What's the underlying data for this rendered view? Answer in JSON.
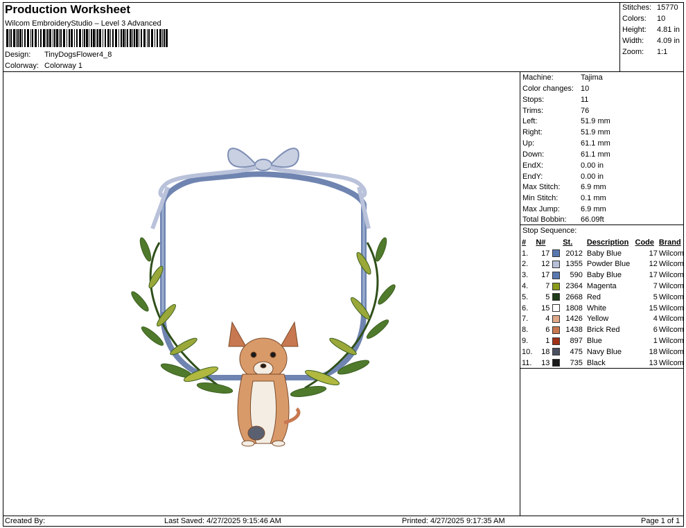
{
  "header": {
    "title": "Production Worksheet",
    "subtitle": "Wilcom EmbroideryStudio – Level 3 Advanced",
    "design_label": "Design:",
    "design_value": "TinyDogsFlower4_8",
    "colorway_label": "Colorway:",
    "colorway_value": "Colorway 1"
  },
  "summary": [
    {
      "label": "Stitches:",
      "value": "15770"
    },
    {
      "label": "Colors:",
      "value": "10"
    },
    {
      "label": "Height:",
      "value": "4.81 in"
    },
    {
      "label": "Width:",
      "value": "4.09 in"
    },
    {
      "label": "Zoom:",
      "value": "1:1"
    }
  ],
  "machine_info": [
    {
      "label": "Machine:",
      "value": "Tajima"
    },
    {
      "label": "Color changes:",
      "value": "10"
    },
    {
      "label": "Stops:",
      "value": "11"
    },
    {
      "label": "Trims:",
      "value": "76"
    },
    {
      "label": "Left:",
      "value": "51.9 mm"
    },
    {
      "label": "Right:",
      "value": "51.9 mm"
    },
    {
      "label": "Up:",
      "value": "61.1 mm"
    },
    {
      "label": "Down:",
      "value": "61.1 mm"
    },
    {
      "label": "EndX:",
      "value": "0.00 in"
    },
    {
      "label": "EndY:",
      "value": "0.00 in"
    },
    {
      "label": "Max Stitch:",
      "value": "6.9 mm"
    },
    {
      "label": "Min Stitch:",
      "value": "0.1 mm"
    },
    {
      "label": "Max Jump:",
      "value": "6.9 mm"
    },
    {
      "label": "Total Bobbin:",
      "value": "66.09ft"
    }
  ],
  "stop_sequence": {
    "title": "Stop Sequence:",
    "headers": {
      "idx": "#",
      "n": "N#",
      "st": "St.",
      "desc": "Description",
      "code": "Code",
      "brand": "Brand"
    },
    "rows": [
      {
        "idx": "1.",
        "n": "17",
        "color": "#5a78b0",
        "st": "2012",
        "desc": "Baby Blue",
        "code": "17",
        "brand": "Wilcom"
      },
      {
        "idx": "2.",
        "n": "12",
        "color": "#b8c0d8",
        "st": "1355",
        "desc": "Powder Blue",
        "code": "12",
        "brand": "Wilcom"
      },
      {
        "idx": "3.",
        "n": "17",
        "color": "#5a78b0",
        "st": "590",
        "desc": "Baby Blue",
        "code": "17",
        "brand": "Wilcom"
      },
      {
        "idx": "4.",
        "n": "7",
        "color": "#8a9a1a",
        "st": "2364",
        "desc": "Magenta",
        "code": "7",
        "brand": "Wilcom"
      },
      {
        "idx": "5.",
        "n": "5",
        "color": "#1f3d1a",
        "st": "2668",
        "desc": "Red",
        "code": "5",
        "brand": "Wilcom"
      },
      {
        "idx": "6.",
        "n": "15",
        "color": "#ffffff",
        "st": "1808",
        "desc": "White",
        "code": "15",
        "brand": "Wilcom"
      },
      {
        "idx": "7.",
        "n": "4",
        "color": "#e0a88a",
        "st": "1426",
        "desc": "Yellow",
        "code": "4",
        "brand": "Wilcom"
      },
      {
        "idx": "8.",
        "n": "6",
        "color": "#c87850",
        "st": "1438",
        "desc": "Brick Red",
        "code": "6",
        "brand": "Wilcom"
      },
      {
        "idx": "9.",
        "n": "1",
        "color": "#a03018",
        "st": "897",
        "desc": "Blue",
        "code": "1",
        "brand": "Wilcom"
      },
      {
        "idx": "10.",
        "n": "18",
        "color": "#4a5060",
        "st": "475",
        "desc": "Navy Blue",
        "code": "18",
        "brand": "Wilcom"
      },
      {
        "idx": "11.",
        "n": "13",
        "color": "#1a1a1a",
        "st": "735",
        "desc": "Black",
        "code": "13",
        "brand": "Wilcom"
      }
    ]
  },
  "footer": {
    "created_by": "Created By:",
    "last_saved": "Last Saved: 4/27/2025 9:15:46 AM",
    "printed": "Printed: 4/27/2025 9:17:35 AM",
    "page": "Page 1 of 1"
  }
}
